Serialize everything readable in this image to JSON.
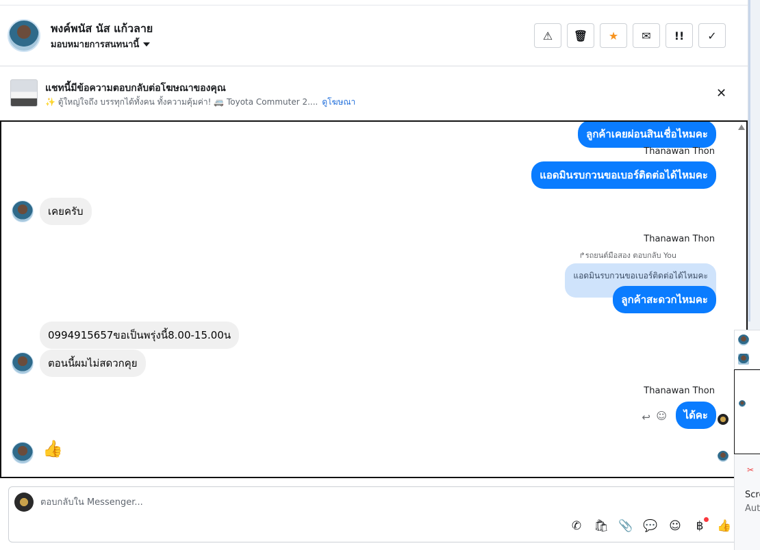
{
  "header": {
    "contact_name": "พงค์พนัส นัส แก้วลาย",
    "assign_label": "มอบหมายการสนทนานี้",
    "toolbar": [
      {
        "icon": "warning-icon",
        "glyph": "⚠"
      },
      {
        "icon": "trash-icon",
        "glyph": "🗑"
      },
      {
        "icon": "star-icon",
        "glyph": "★"
      },
      {
        "icon": "envelope-open-icon",
        "glyph": "✉"
      },
      {
        "icon": "priority-icon",
        "glyph": "!!"
      },
      {
        "icon": "check-icon",
        "glyph": "✓"
      }
    ]
  },
  "ad": {
    "title": "แชทนี้มีข้อความตอบกลับต่อโฆษณาของคุณ",
    "subtitle": "✨ ตู้ใหญ่ใจถึง บรรทุกได้ทั้งคน ทั้งความคุ้มค่า! 🚐 Toyota Commuter 2....",
    "link": "ดูโฆษณา",
    "close_glyph": "✕"
  },
  "thread": {
    "messages": {
      "m1": "ลูกค้าเคยผ่อนสินเชื่อไหมคะ",
      "sender1": "Thanawan Thon",
      "m2": "แอดมินรบกวนขอเบอร์ติดต่อได้ไหมคะ",
      "m3": "เคยครับ",
      "sender2": "Thanawan Thon",
      "reply_meta": "↱รถยนต์มือสอง ตอบกลับ You",
      "quoted": "แอดมินรบกวนขอเบอร์ติดต่อได้ไหมคะ",
      "m4": "ลูกค้าสะดวกไหมคะ",
      "m5": "0994915657ขอเป็นพรุ่งนี้8.00-15.00น",
      "m6": "ตอนนี้ผมไม่สดวกคุย",
      "sender3": "Thanawan Thon",
      "m7": "ได้คะ",
      "like_glyph": "👍"
    }
  },
  "composer": {
    "placeholder": "ตอบกลับใน Messenger...",
    "tools": [
      {
        "icon": "call-add-icon",
        "glyph": "✆"
      },
      {
        "icon": "shopping-bag-icon",
        "glyph": "🛍"
      },
      {
        "icon": "paperclip-icon",
        "glyph": "📎"
      },
      {
        "icon": "chat-bubble-icon",
        "glyph": "💬"
      },
      {
        "icon": "emoji-icon",
        "glyph": "☺"
      },
      {
        "icon": "baht-icon",
        "glyph": "฿"
      },
      {
        "icon": "thumbs-up-icon",
        "glyph": "👍"
      }
    ]
  },
  "side_panel": {
    "screen_label": "Scre",
    "auto_label": "Auto"
  },
  "colors": {
    "accent": "#0a7cff",
    "incoming_bubble": "#f0f0f0",
    "quoted_bubble": "#cfe3fb",
    "star": "#f7931e",
    "notification": "#fa383e"
  }
}
